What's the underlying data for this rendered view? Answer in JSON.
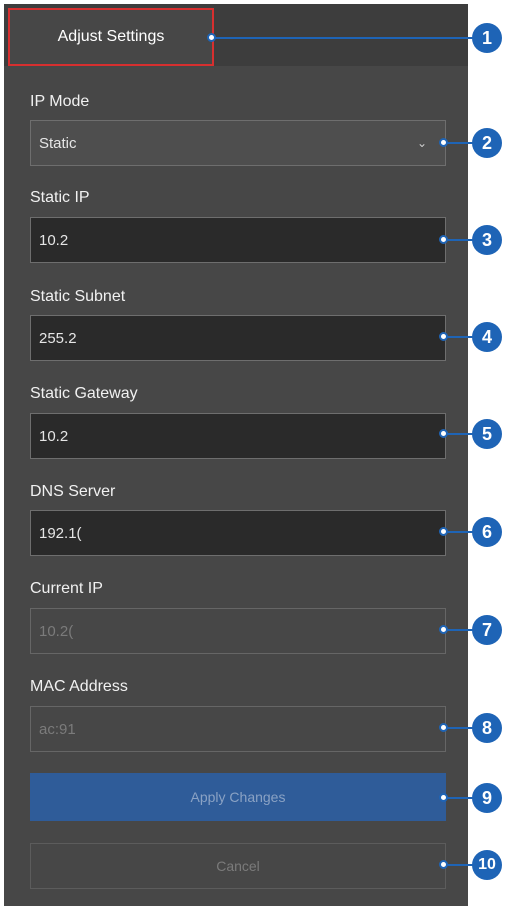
{
  "tab": {
    "label": "Adjust Settings"
  },
  "fields": {
    "ip_mode": {
      "label": "IP Mode",
      "value": "Static"
    },
    "static_ip": {
      "label": "Static IP",
      "value": "10.2"
    },
    "static_subnet": {
      "label": "Static Subnet",
      "value": "255.2"
    },
    "static_gateway": {
      "label": "Static Gateway",
      "value": "10.2"
    },
    "dns_server": {
      "label": "DNS Server",
      "value": "192.1("
    },
    "current_ip": {
      "label": "Current IP",
      "value": "10.2("
    },
    "mac_address": {
      "label": "MAC Address",
      "value": "ac:91"
    }
  },
  "buttons": {
    "apply": "Apply Changes",
    "cancel": "Cancel"
  },
  "callouts": [
    "1",
    "2",
    "3",
    "4",
    "5",
    "6",
    "7",
    "8",
    "9",
    "10"
  ],
  "colors": {
    "accent": "#1e64b6",
    "tab_highlight": "#d72f2f",
    "primary_button": "#2f5c99",
    "panel": "#474747"
  },
  "icons": {
    "select_arrow": "chevron-down-icon"
  }
}
